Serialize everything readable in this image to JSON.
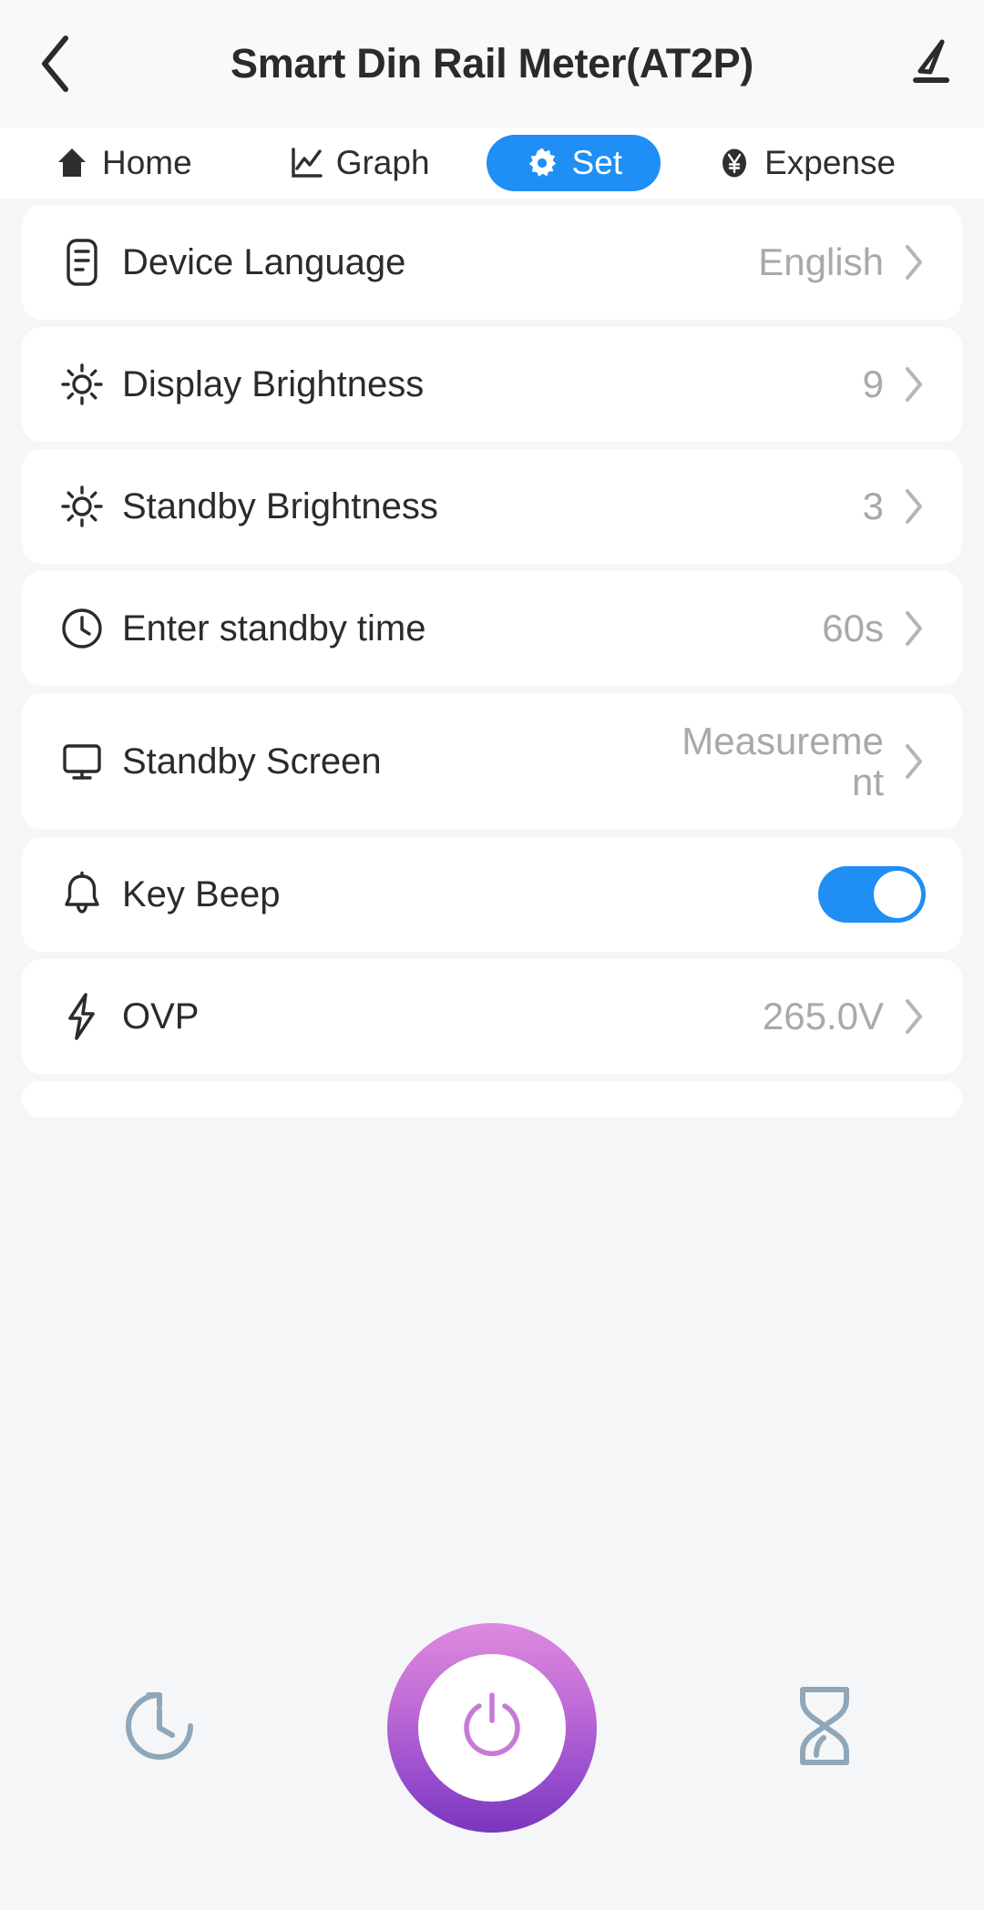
{
  "header": {
    "title": "Smart Din Rail Meter(AT2P)",
    "back_icon": "chevron-left-icon",
    "edit_icon": "pencil-edit-icon"
  },
  "tabs": [
    {
      "label": "Home",
      "icon": "home-icon",
      "active": false
    },
    {
      "label": "Graph",
      "icon": "line-chart-icon",
      "active": false
    },
    {
      "label": "Set",
      "icon": "gear-icon",
      "active": true
    },
    {
      "label": "Expense",
      "icon": "yen-coin-icon",
      "active": false
    }
  ],
  "settings": [
    {
      "label": "Device Language",
      "value": "English",
      "icon": "document-list-icon",
      "type": "link"
    },
    {
      "label": "Display Brightness",
      "value": "9",
      "icon": "sun-brightness-icon",
      "type": "link"
    },
    {
      "label": "Standby Brightness",
      "value": "3",
      "icon": "sun-brightness-icon",
      "type": "link"
    },
    {
      "label": "Enter standby time",
      "value": "60s",
      "icon": "clock-icon",
      "type": "link"
    },
    {
      "label": "Standby Screen",
      "value": "Measurement",
      "icon": "monitor-icon",
      "type": "link"
    },
    {
      "label": "Key Beep",
      "value": "on",
      "icon": "bell-icon",
      "type": "toggle"
    },
    {
      "label": "OVP",
      "value": "265.0V",
      "icon": "lightning-bolt-icon",
      "type": "link"
    }
  ],
  "bottom_bar": {
    "history_icon": "clock-rotate-history-icon",
    "power_icon": "power-button-icon",
    "timer_icon": "hourglass-timer-icon"
  },
  "colors": {
    "accent_blue": "#1f8ef5",
    "page_bg": "#f5f6f7",
    "card_bg": "#ffffff",
    "value_gray": "#a9a9a9",
    "label_dark": "#2b2b2b",
    "bottom_icon_gray": "#8fa7b8",
    "power_gradient_top": "#dd8ade",
    "power_gradient_bottom": "#7a36bd"
  }
}
